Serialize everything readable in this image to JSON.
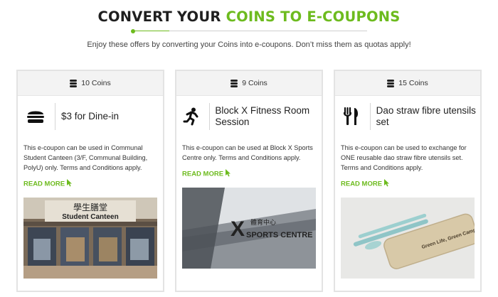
{
  "header": {
    "title_part1": "CONVERT YOUR ",
    "title_part2": "COINS TO E-COUPONS",
    "subtitle": "Enjoy these offers by converting your Coins into e-coupons. Don’t miss them as quotas apply!"
  },
  "colors": {
    "accent": "#6dbb1e",
    "card_header_bg": "#f3f3f3",
    "text": "#222222"
  },
  "cards": [
    {
      "coins": "10 Coins",
      "icon": "burger-icon",
      "title": "$3 for Dine-in",
      "description": "This e-coupon can be used in Communal Student Canteen (3/F, Communal Building, PolyU) only. Terms and Conditions apply.",
      "read_more": "READ MORE",
      "photo": "student-canteen-photo",
      "photo_sign_cn": "學生膳堂",
      "photo_sign_en": "Student Canteen"
    },
    {
      "coins": "9 Coins",
      "icon": "running-person-icon",
      "title": "Block X Fitness Room Session",
      "description": "This e-coupon can be used at Block X Sports Centre only. Terms and Conditions apply.",
      "read_more": "READ MORE",
      "photo": "sports-centre-photo",
      "photo_sign_letter": "X",
      "photo_sign_cn": "體育中心",
      "photo_sign_en": "SPORTS CENTRE"
    },
    {
      "coins": "15 Coins",
      "icon": "utensils-icon",
      "title": "Dao straw fibre utensils set",
      "description": "This e-coupon can be used to exchange for ONE reusable dao straw fibre utensils set. Terms and Conditions apply.",
      "read_more": "READ MORE",
      "photo": "utensils-set-photo",
      "photo_case_text": "Green Life, Green Campus"
    }
  ]
}
